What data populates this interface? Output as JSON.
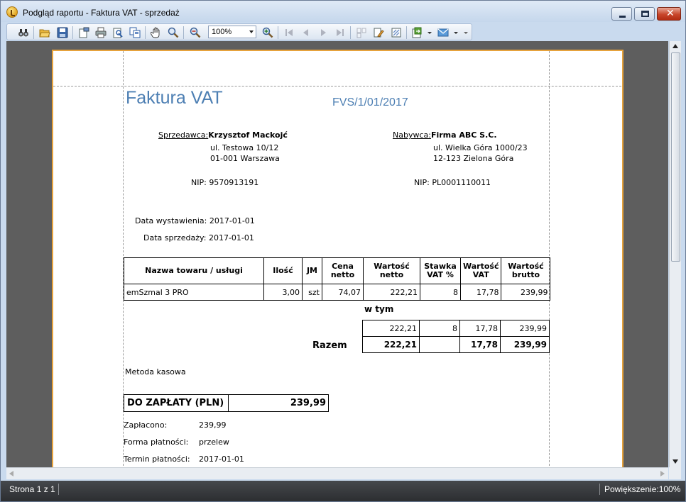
{
  "window": {
    "title": "Podgląd raportu - Faktura VAT - sprzedaż"
  },
  "toolbar": {
    "zoom_value": "100%"
  },
  "document": {
    "title": "Faktura VAT",
    "number": "FVS/1/01/2017",
    "seller": {
      "label": "Sprzedawca:",
      "name": "Krzysztof Mackojć",
      "address_line1": "ul. Testowa 10/12",
      "address_line2": "01-001 Warszawa",
      "nip_label": "NIP:",
      "nip": "9570913191"
    },
    "buyer": {
      "label": "Nabywca:",
      "name": "Firma ABC S.C.",
      "address_line1": "ul. Wielka Góra 1000/23",
      "address_line2": "12-123 Zielona Góra",
      "nip_label": "NIP:",
      "nip": "PL0001110011"
    },
    "issue_date_label": "Data wystawienia:",
    "issue_date": "2017-01-01",
    "sale_date_label": "Data sprzedaży:",
    "sale_date": "2017-01-01",
    "table": {
      "headers": [
        "Nazwa towaru / usługi",
        "Ilość",
        "JM",
        "Cena netto",
        "Wartość netto",
        "Stawka VAT %",
        "Wartość VAT",
        "Wartość brutto"
      ],
      "rows": [
        {
          "name": "emSzmal 3 PRO",
          "qty": "3,00",
          "unit": "szt",
          "price": "74,07",
          "net": "222,21",
          "vat_rate": "8",
          "vat": "17,78",
          "gross": "239,99"
        }
      ]
    },
    "w_tym_label": "w tym",
    "summary_row": {
      "net": "222,21",
      "vat_rate": "8",
      "vat": "17,78",
      "gross": "239,99"
    },
    "razem_label": "Razem",
    "razem_row": {
      "net": "222,21",
      "vat_rate": "",
      "vat": "17,78",
      "gross": "239,99"
    },
    "payment_method_text": "Metoda kasowa",
    "to_pay_label": "DO ZAPŁATY (PLN)",
    "to_pay_value": "239,99",
    "paid_label": "Zapłacono:",
    "paid_value": "239,99",
    "pay_form_label": "Forma płatności:",
    "pay_form_value": "przelew",
    "pay_term_label": "Termin płatności:",
    "pay_term_value": "2017-01-01"
  },
  "status": {
    "page_info": "Strona 1 z 1",
    "zoom_info": "Powiększenie:100%"
  }
}
